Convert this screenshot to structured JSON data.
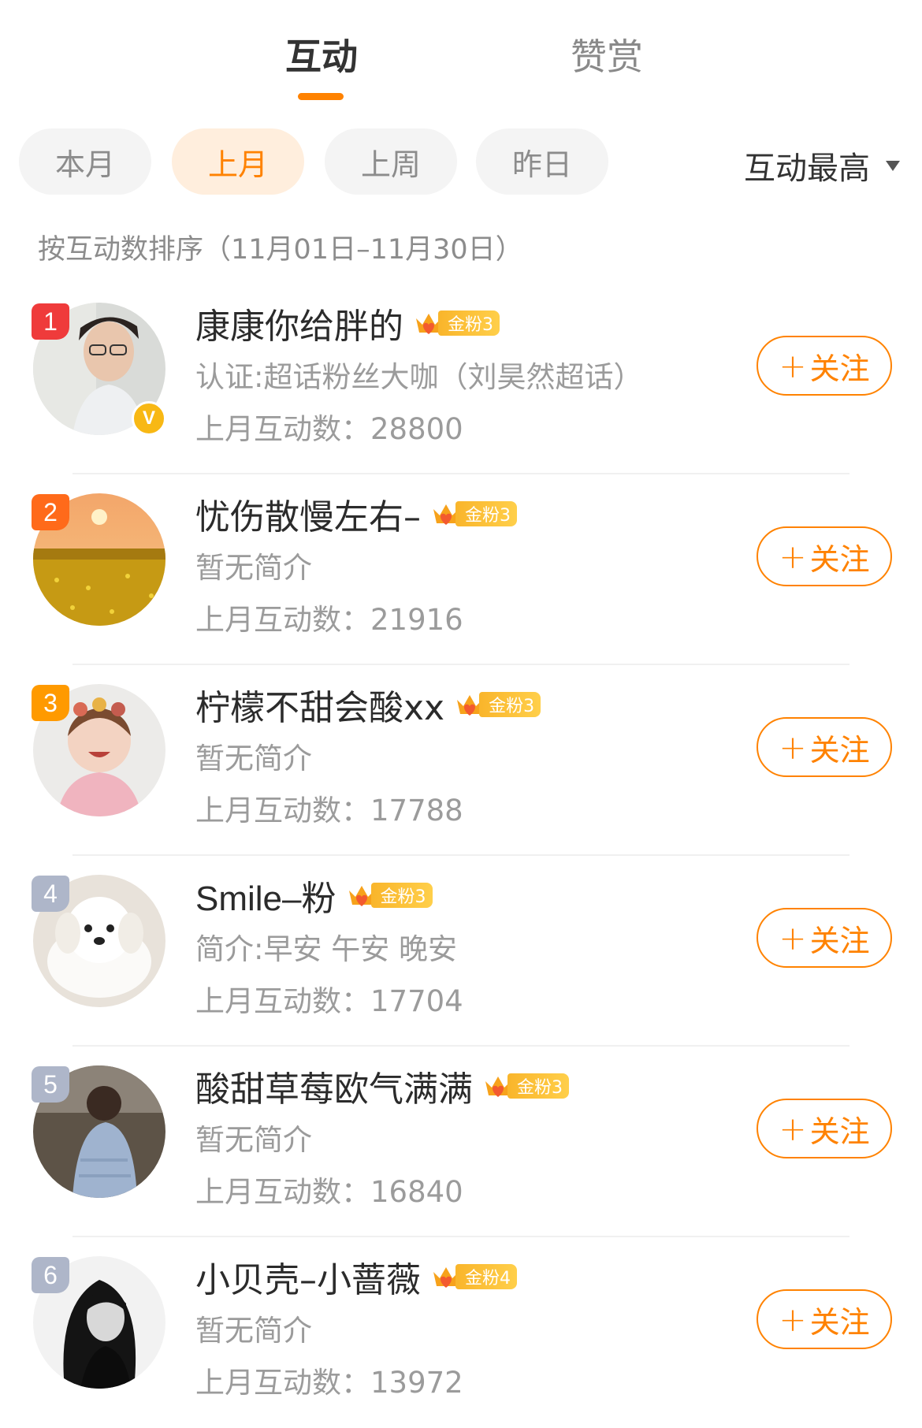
{
  "tabs": {
    "interact": "互动",
    "reward": "赞赏"
  },
  "filters": {
    "chips": [
      "本月",
      "上月",
      "上周",
      "昨日"
    ],
    "active_index": 1,
    "sort_label": "互动最高"
  },
  "range_text": "按互动数排序（11月01日–11月30日）",
  "colors": {
    "accent": "#ff8200",
    "rank1": "#ef3b3b",
    "rank2": "#ff6a1a",
    "rank3": "#ff9a00",
    "rank_other": "#aeb6c9"
  },
  "users": [
    {
      "rank": "1",
      "name": "康康你给胖的",
      "badge": "金粉3",
      "desc": "认证:超话粉丝大咖（刘昊然超话）",
      "count": "上月互动数：28800",
      "verified": true,
      "follow": "关注",
      "avatar_icon": "man-with-glasses-avatar"
    },
    {
      "rank": "2",
      "name": "忧伤散慢左右–",
      "badge": "金粉3",
      "desc": "暂无简介",
      "count": "上月互动数：21916",
      "verified": false,
      "follow": "关注",
      "avatar_icon": "flower-field-sunset-avatar"
    },
    {
      "rank": "3",
      "name": "柠檬不甜会酸xx",
      "badge": "金粉3",
      "desc": "暂无简介",
      "count": "上月互动数：17788",
      "verified": false,
      "follow": "关注",
      "avatar_icon": "little-girl-avatar"
    },
    {
      "rank": "4",
      "name": "Smile–粉",
      "badge": "金粉3",
      "desc": "简介:早安 午安 晚安",
      "count": "上月互动数：17704",
      "verified": false,
      "follow": "关注",
      "avatar_icon": "white-puppy-avatar"
    },
    {
      "rank": "5",
      "name": "酸甜草莓欧气满满",
      "badge": "金粉3",
      "desc": "暂无简介",
      "count": "上月互动数：16840",
      "verified": false,
      "follow": "关注",
      "avatar_icon": "girl-back-view-avatar"
    },
    {
      "rank": "6",
      "name": "小贝壳–小蔷薇",
      "badge": "金粉4",
      "desc": "暂无简介",
      "count": "上月互动数：13972",
      "verified": false,
      "follow": "关注",
      "avatar_icon": "bw-woman-portrait-avatar"
    }
  ]
}
